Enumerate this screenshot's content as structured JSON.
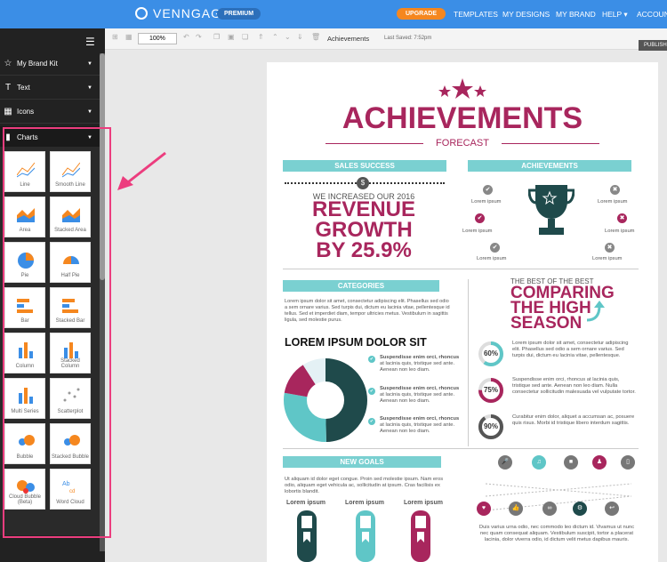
{
  "topbar": {
    "brand": "VENNGAGE",
    "premium": "PREMIUM",
    "upgrade": "UPGRADE",
    "nav": [
      "TEMPLATES",
      "MY DESIGNS",
      "MY BRAND",
      "HELP ▾",
      "ACCOUNT"
    ]
  },
  "sidebar": {
    "items": [
      {
        "label": "My Brand Kit",
        "icon": "☆"
      },
      {
        "label": "Text",
        "icon": "T"
      },
      {
        "label": "Icons",
        "icon": "▦"
      },
      {
        "label": "Charts",
        "icon": "▮"
      }
    ],
    "tiles": [
      {
        "label": "Line"
      },
      {
        "label": "Smooth Line"
      },
      {
        "label": "Area"
      },
      {
        "label": "Stacked Area"
      },
      {
        "label": "Pie"
      },
      {
        "label": "Half Pie"
      },
      {
        "label": "Bar"
      },
      {
        "label": "Stacked Bar"
      },
      {
        "label": "Column"
      },
      {
        "label": "Stacked Column"
      },
      {
        "label": "Multi Series"
      },
      {
        "label": "Scatterplot"
      },
      {
        "label": "Bubble"
      },
      {
        "label": "Stacked Bubble"
      },
      {
        "label": "Cloud Bubble (Beta)"
      },
      {
        "label": "Word Cloud"
      }
    ]
  },
  "toolbar": {
    "zoom": "100%",
    "title": "Achievements",
    "saved": "Last Saved: 7:52pm",
    "publish": "PUBLISH"
  },
  "doc": {
    "title": "ACHIEVEMENTS",
    "subtitle": "FORECAST",
    "sales": {
      "ribbon": "SALES SUCCESS",
      "line1": "WE INCREASED OUR 2016",
      "big": [
        "REVENUE",
        "GROWTH",
        "BY 25.9%"
      ]
    },
    "achv": {
      "ribbon": "ACHIEVEMENTS",
      "items": [
        "Lorem ipsum",
        "Lorem ipsum",
        "Lorem ipsum",
        "Lorem ipsum",
        "Lorem ipsum",
        "Lorem ipsum"
      ]
    },
    "categories": {
      "ribbon": "CATEGORIES",
      "body": "Lorem ipsum dolor sit amet, consectetur adipiscing elit. Phasellus sed odio a sem ornare varius. Sed turpis dui, dictum eu lacinia vitae, pellentesque id tellus. Sed et imperdiet diam, tempor ultricies metus. Vestibulum in sagittis ligula, sed molestie purus.",
      "heading": "LOREM IPSUM DOLOR SIT",
      "points": [
        {
          "b": "Suspendisse enim orci, rhoncus",
          "t": "at lacinia quis, tristique sed ante. Aenean non leo diam."
        },
        {
          "b": "Suspendisse enim orci, rhoncus",
          "t": "at lacinia quis, tristique sed ante. Aenean non leo diam."
        },
        {
          "b": "Suspendisse enim orci, rhoncus",
          "t": "at lacinia quis, tristique sed ante. Aenean non leo diam."
        }
      ]
    },
    "compare": {
      "pre": "THE BEST OF THE BEST",
      "big": [
        "COMPARING",
        "THE HIGH",
        "SEASON"
      ],
      "items": [
        {
          "pct": "60%",
          "value": 0.6,
          "t": "Lorem ipsum dolor sit amet, consectetur adipiscing elit. Phasellus sed odio a sem ornare varius. Sed turpis dui, dictum eu lacinia vitae, pellentesque."
        },
        {
          "pct": "75%",
          "value": 0.75,
          "t": "Suspendisse enim orci, rhoncus at lacinia quis, tristique sed ante. Aenean non leo diam. Nulla consectetur sollicitudin malesuada vel vulputate tortor."
        },
        {
          "pct": "90%",
          "value": 0.9,
          "t": "Curabitur enim dolor, aliquet a accumsan ac, posuere quis risus. Morbi id tristique libero interdum sagittis."
        }
      ]
    },
    "goals": {
      "ribbon": "NEW GOALS",
      "body": "Ut aliquam id dolor eget congue. Proin sed molestie ipsum. Nam eros odio, aliquam eget vehicula ac, sollicitudin at ipsum. Cras facilisis ex lobortis blandit.",
      "labels": [
        "Lorem ipsum",
        "Lorem ipsum",
        "Lorem ipsum"
      ]
    },
    "footer": "Duis varius urna odio, nec commodo leo dictum id. Vivamus ut nunc nec quam consequat aliquam. Vestibulum suscipit, tortor a placerat lacinia, dolor viverra odio, id dictum velit metus dapibus mauris."
  }
}
